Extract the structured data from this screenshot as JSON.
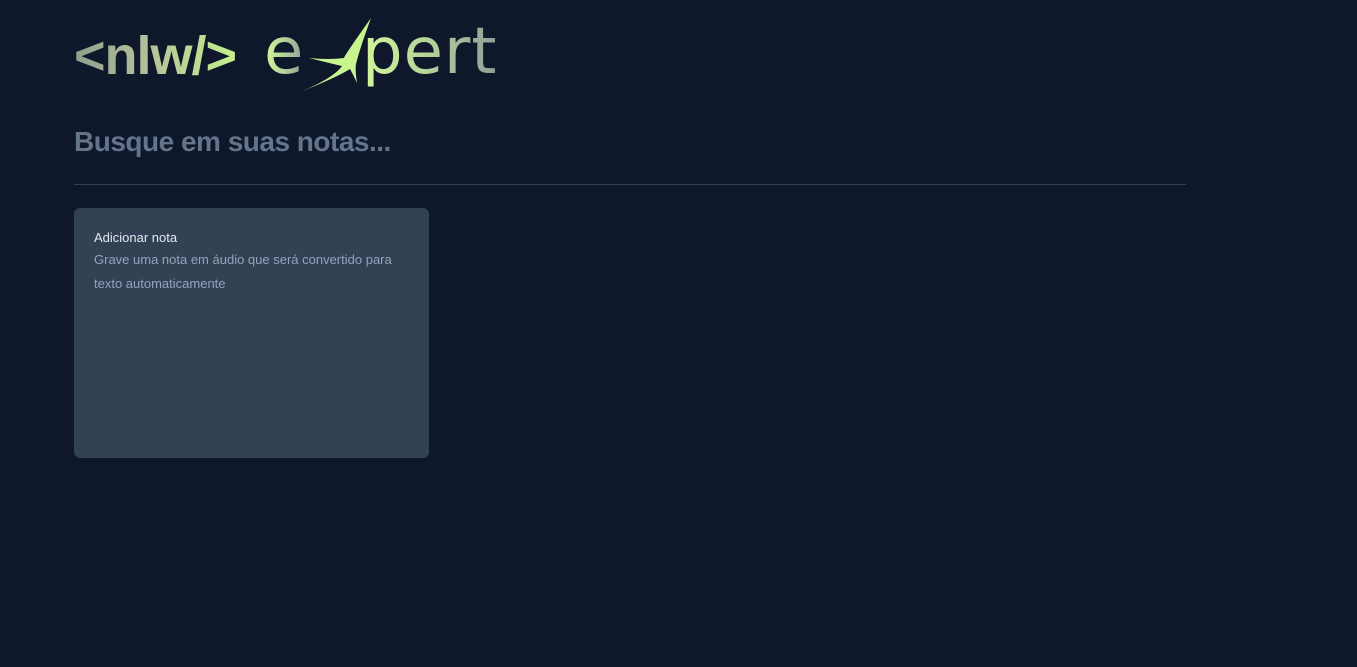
{
  "brand": {
    "logo_left": "<nlw/>",
    "logo_right": "expert"
  },
  "search": {
    "placeholder": "Busque em suas notas...",
    "value": ""
  },
  "notes": {
    "add_card": {
      "title": "Adicionar nota",
      "description": "Grave uma nota em áudio que será convertido para texto automaticamente"
    }
  },
  "colors": {
    "background": "#0f172a",
    "card": "#334155",
    "accent_lime": "#c8f58e",
    "logo_gray": "#a7b3a2",
    "divider": "#334155",
    "placeholder": "#64748b"
  }
}
